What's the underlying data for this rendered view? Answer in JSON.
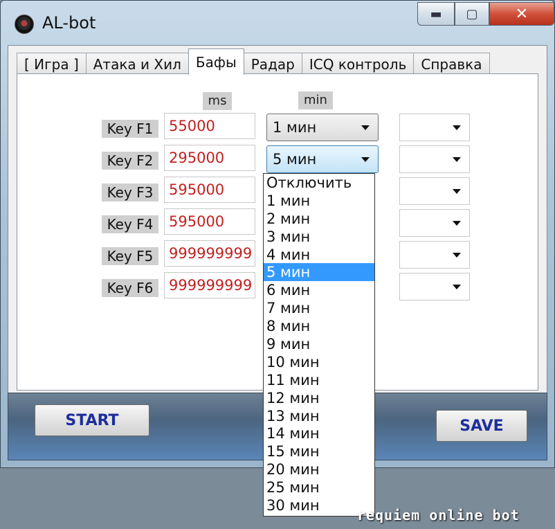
{
  "window": {
    "title": "AL-bot",
    "min_glyph": "▬",
    "max_glyph": "▢",
    "close_glyph": "✕"
  },
  "tabs": [
    {
      "label": "[ Игра ]"
    },
    {
      "label": "Атака и Хил"
    },
    {
      "label": "Бафы",
      "active": true
    },
    {
      "label": "Радар"
    },
    {
      "label": "ICQ контроль"
    },
    {
      "label": "Справка"
    }
  ],
  "headers": {
    "ms": "ms",
    "min": "min"
  },
  "keys": [
    {
      "label": "Key F1",
      "ms": "55000",
      "interval": "1 мин"
    },
    {
      "label": "Key F2",
      "ms": "295000",
      "interval": "5 мин"
    },
    {
      "label": "Key F3",
      "ms": "595000"
    },
    {
      "label": "Key F4",
      "ms": "595000"
    },
    {
      "label": "Key F5",
      "ms": "999999999"
    },
    {
      "label": "Key F6",
      "ms": "999999999"
    }
  ],
  "dropdown": {
    "options": [
      "Отключить",
      "1 мин",
      "2 мин",
      "3 мин",
      "4 мин",
      "5 мин",
      "6 мин",
      "7 мин",
      "8 мин",
      "9 мин",
      "10 мин",
      "11 мин",
      "12 мин",
      "13 мин",
      "14 мин",
      "15 мин",
      "20 мин",
      "25 мин",
      "30 мин"
    ],
    "selected": "5 мин"
  },
  "buttons": {
    "start": "START",
    "save": "SAVE"
  },
  "watermark": "requiem online bot",
  "colors": {
    "value_text": "#c42020",
    "button_text": "#1d2e9c",
    "selection": "#3399ff"
  }
}
